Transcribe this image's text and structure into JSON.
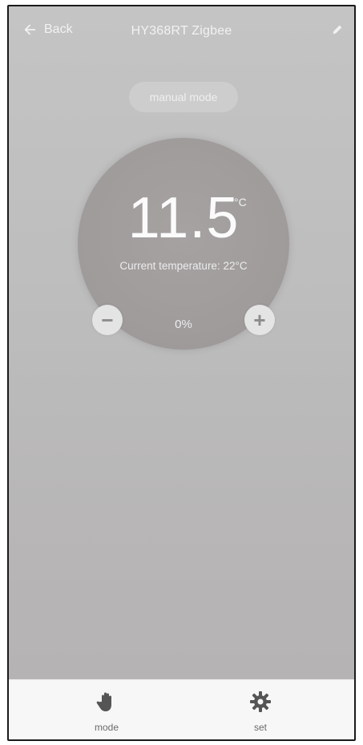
{
  "header": {
    "back_label": "Back",
    "title": "HY368RT Zigbee",
    "edit_icon": "pencil-icon"
  },
  "mode": {
    "label": "manual  mode"
  },
  "dial": {
    "set_temperature": "11.5",
    "unit": "°C",
    "current_label": "Current temperature: 22°C",
    "valve_percent": "0%",
    "minus_label": "−",
    "plus_label": "+"
  },
  "bottom_bar": {
    "tabs": [
      {
        "label": "mode",
        "icon": "hand-icon"
      },
      {
        "label": "set",
        "icon": "gear-icon"
      }
    ]
  },
  "colors": {
    "background": "#bdbdbd",
    "dial": "#a09c9c",
    "text": "#f2f2f2",
    "bottom_bar": "#f7f7f7"
  }
}
